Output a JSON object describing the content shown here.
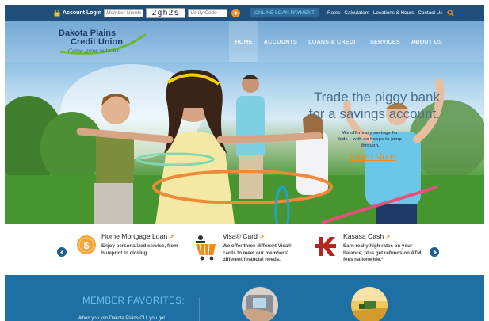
{
  "topbar": {
    "account_login": "Account Login",
    "member_placeholder": "Member Number",
    "captcha_text": "2gh2s",
    "verify_placeholder": "Verify Code",
    "online_loan_payment": "ONLINE LOAN PAYMENT",
    "links": [
      "Rates",
      "Calculators",
      "Locations & Hours",
      "Contact Us"
    ]
  },
  "logo": {
    "line1": "Dakota Plains",
    "line2": "Credit Union",
    "tagline": "Come grow with us!"
  },
  "nav": {
    "items": [
      "HOME",
      "ACCOUNTS",
      "LOANS & CREDIT",
      "SERVICES",
      "ABOUT US"
    ],
    "active_index": 0
  },
  "hero": {
    "headline_line1": "Trade the piggy bank",
    "headline_line2": "for a savings account.",
    "subtext": "We offer easy savings for kids – with no hoops to jump through.",
    "cta": "Learn More"
  },
  "features": [
    {
      "title": "Home Mortgage Loan",
      "chevron": ">",
      "description": "Enjoy personalized service, from blueprint to closing.",
      "icon": "dollar-coin-icon"
    },
    {
      "title": "Visa® Card",
      "chevron": ">",
      "description": "We offer three different Visa® cards to meet our members' different financial needs.",
      "icon": "shopping-cart-icon"
    },
    {
      "title": "Kasasa Cash",
      "chevron": ">",
      "description": "Earn really high rates on your balance, plus get refunds on ATM fees nationwide.*",
      "icon": "kasasa-logo-icon"
    }
  ],
  "favorites": {
    "title": "MEMBER FAVORITES:",
    "text": "When you join Dakota Plains CU, you get"
  },
  "colors": {
    "topbar_bg": "#1f4f7a",
    "accent_orange": "#f08a1c",
    "favorites_bg": "#1e6fa3",
    "logo_navy": "#1d3c6a"
  }
}
